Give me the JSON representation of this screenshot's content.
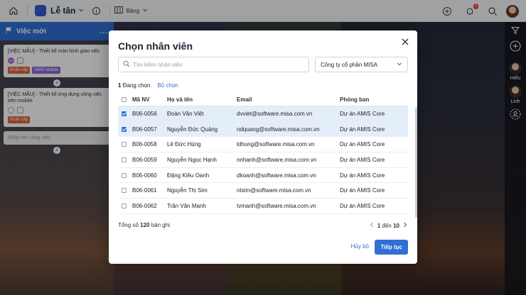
{
  "topbar": {
    "title": "Lễ tân",
    "view_label": "Bảng",
    "notification_count": "2"
  },
  "board": {
    "column_title": "Việc mới",
    "column_more": "...",
    "cards": [
      {
        "title": "[VIỆC MẪU] - Thiết kế màn hình giao việc",
        "avatar": "LH",
        "tags": [
          "Khẩn cấp",
          "AMIS Mobile"
        ]
      },
      {
        "title": "[VIỆC MẪU] - Thiết kế ứng dụng công việc trên mobile",
        "tags": [
          "Khẩn cấp"
        ]
      }
    ],
    "new_card_placeholder": "Nhập tên công việc"
  },
  "rail": {
    "users": [
      {
        "name": "Hiếu"
      },
      {
        "name": "Linh"
      }
    ]
  },
  "modal": {
    "title": "Chọn nhân viên",
    "search_placeholder": "Tìm kiếm nhân viên",
    "company": "Công ty cổ phần MISA",
    "selected_count": "1",
    "selected_label": "Đang chọn",
    "deselect_label": "Bỏ chọn",
    "columns": [
      "Mã NV",
      "Họ và tên",
      "Email",
      "Phòng ban"
    ],
    "rows": [
      {
        "id": "B06-0056",
        "name": "Đoàn Văn Việt",
        "email": "dvviet@software.misa.com.vn",
        "dept": "Dự án AMIS Core",
        "checked": true
      },
      {
        "id": "B06-0057",
        "name": "Nguyễn Đức Quảng",
        "email": "ndquang@software.misa.com.vn",
        "dept": "Dự án AMIS Core",
        "checked": true
      },
      {
        "id": "B06-0058",
        "name": "Lê Đức Hùng",
        "email": "ldhung@software.misa.com.vn",
        "dept": "Dự án AMIS Core",
        "checked": false
      },
      {
        "id": "B06-0059",
        "name": "Nguyễn Ngọc Hạnh",
        "email": "nnhanh@software.misa.com.vn",
        "dept": "Dự án AMIS Core",
        "checked": false
      },
      {
        "id": "B06-0060",
        "name": "Đặng Kiều Oanh",
        "email": "dkoanh@software.misa.com.vn",
        "dept": "Dự án AMIS Core",
        "checked": false
      },
      {
        "id": "B06-0061",
        "name": "Nguyễn Thị Sim",
        "email": "ntsim@software.misa.com.vn",
        "dept": "Dự án AMIS Core",
        "checked": false
      },
      {
        "id": "B06-0062",
        "name": "Trần Văn Mạnh",
        "email": "tvmanh@software.misa.com.vn",
        "dept": "Dự án AMIS Core",
        "checked": false
      }
    ],
    "total_prefix": "Tổng số",
    "total_count": "120",
    "total_suffix": "bản ghi",
    "pager_from": "1",
    "pager_sep": "đến",
    "pager_to": "10",
    "cancel_label": "Hủy bỏ",
    "continue_label": "Tiếp tục"
  }
}
